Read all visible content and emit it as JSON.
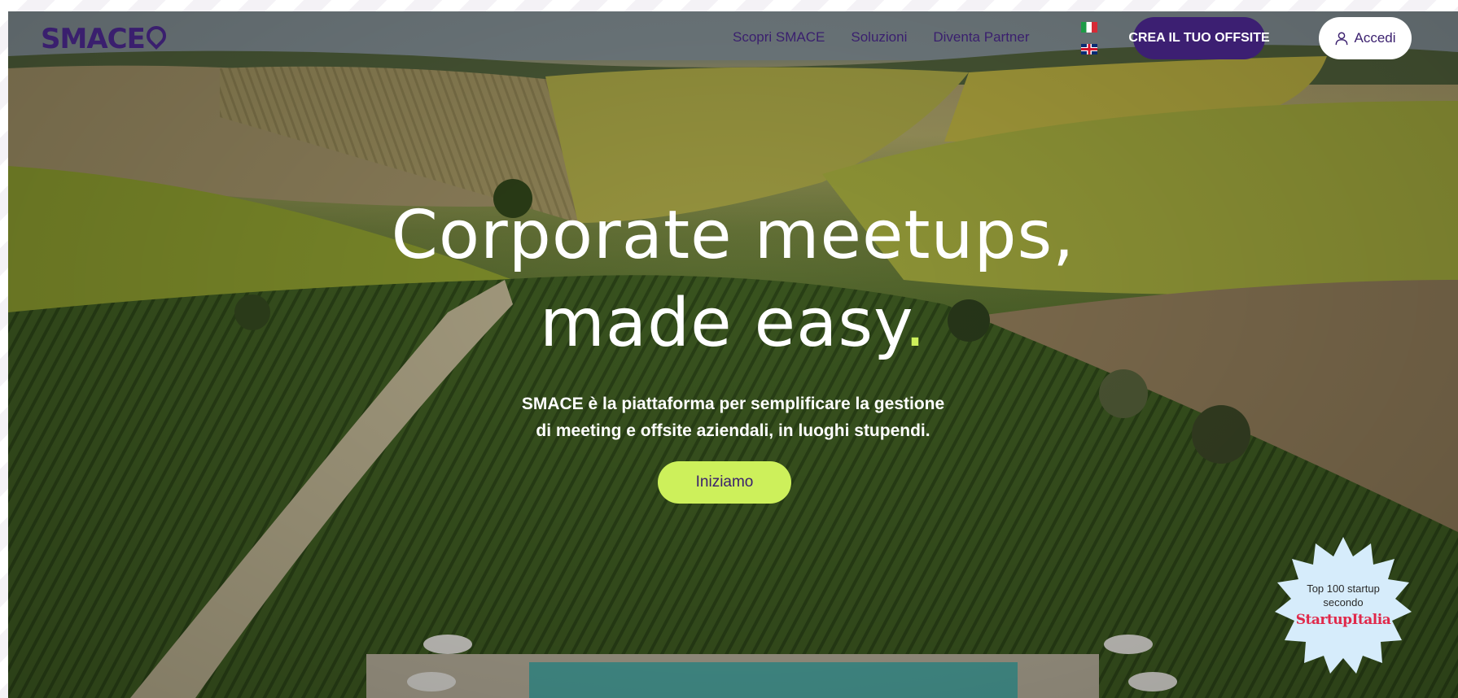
{
  "header": {
    "logo": "SMACE",
    "nav": [
      {
        "label": "Scopri SMACE"
      },
      {
        "label": "Soluzioni"
      },
      {
        "label": "Diventa Partner"
      }
    ],
    "languages": [
      "it-flag-icon",
      "uk-flag-icon"
    ],
    "cta_label": "CREA IL TUO OFFSITE",
    "login_label": "Accedi"
  },
  "hero": {
    "headline_line1": "Corporate meetups,",
    "headline_line2": "made easy",
    "headline_dot": ".",
    "subtitle_line1": "SMACE è la piattaforma per semplificare la gestione",
    "subtitle_line2": "di meeting e offsite aziendali, in luoghi stupendi.",
    "button_label": "Iniziamo"
  },
  "badge": {
    "line1": "Top 100 startup",
    "line2": "secondo",
    "brand": "StartupItalia"
  },
  "colors": {
    "brand_purple": "#3c1f72",
    "accent_lime": "#cdf05b",
    "badge_bg": "#d6ecfb"
  }
}
